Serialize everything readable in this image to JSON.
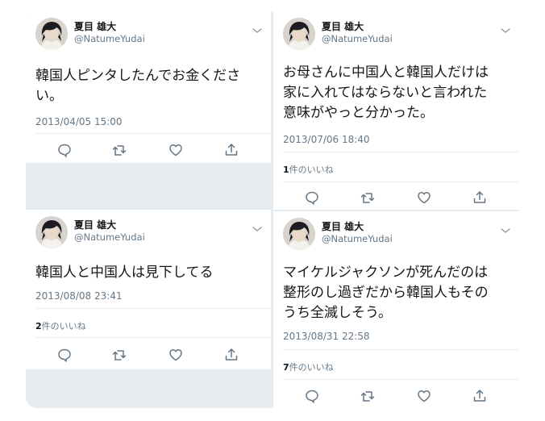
{
  "tweets": [
    {
      "name": "夏目 雄大",
      "handle": "@NatumeYudai",
      "text": "韓国人ピンタしたんでお金くださ\nい。",
      "date": "2013/04/05 15:00",
      "likes_count": "",
      "likes_label": ""
    },
    {
      "name": "夏目 雄大",
      "handle": "@NatumeYudai",
      "text": "お母さんに中国人と韓国人だけは\n家に入れてはならないと言われた\n意味がやっと分かった。",
      "date": "2013/07/06 18:40",
      "likes_count": "1",
      "likes_label": "件のいいね"
    },
    {
      "name": "夏目 雄大",
      "handle": "@NatumeYudai",
      "text": "韓国人と中国人は見下してる",
      "date": "2013/08/08 23:41",
      "likes_count": "2",
      "likes_label": "件のいいね"
    },
    {
      "name": "夏目 雄大",
      "handle": "@NatumeYudai",
      "text": "マイケルジャクソンが死んだのは\n整形のし過ぎだから韓国人もその\nうち全滅しそう。",
      "date": "2013/08/31 22:58",
      "likes_count": "7",
      "likes_label": "件のいいね"
    }
  ],
  "icons": {
    "reply": "reply-icon",
    "retweet": "retweet-icon",
    "like": "heart-icon",
    "share": "share-icon",
    "menu": "chevron-down-icon"
  },
  "colors": {
    "text": "#14171a",
    "muted": "#657786",
    "background": "#e7ecf0"
  }
}
